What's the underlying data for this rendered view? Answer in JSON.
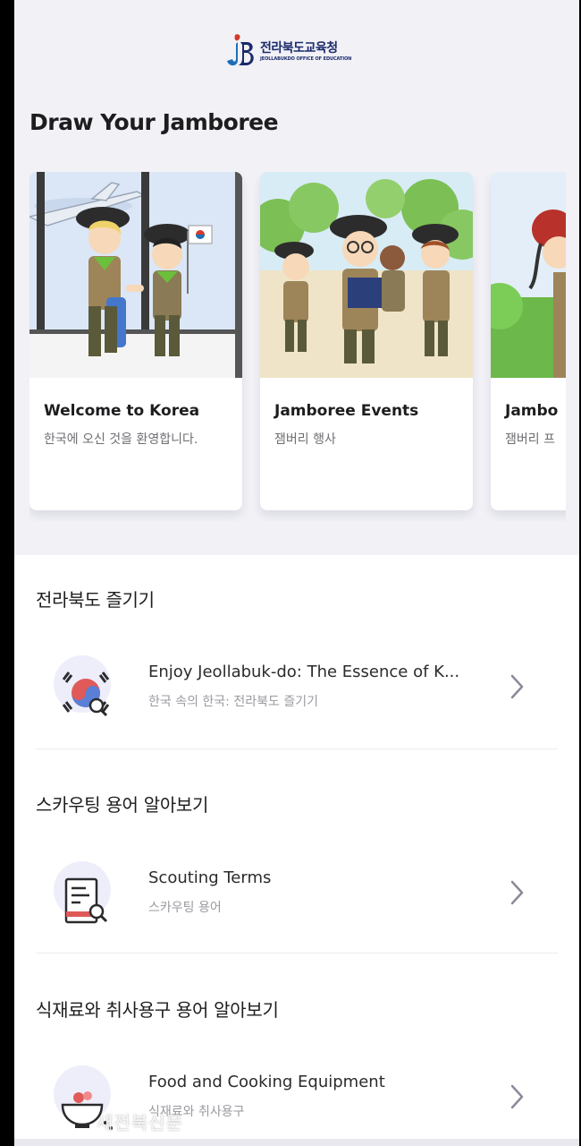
{
  "logo": {
    "ko": "전라북도교육청",
    "en": "JEOLLABUKDO OFFICE OF EDUCATION"
  },
  "page_title": "Draw Your Jamboree",
  "cards": [
    {
      "title": "Welcome to Korea",
      "subtitle": "한국에 오신 것을 환영합니다."
    },
    {
      "title": "Jamboree Events",
      "subtitle": "잼버리 행사"
    },
    {
      "title": "Jambo",
      "subtitle": "잼버리 프"
    }
  ],
  "sections": [
    {
      "title": "전라북도 즐기기",
      "item_title": "Enjoy Jeollabuk-do: The Essence of K...",
      "item_subtitle": "한국 속의 한국: 전라북도 즐기기",
      "icon": "taegeuk-search-icon"
    },
    {
      "title": "스카우팅 용어 알아보기",
      "item_title": "Scouting Terms",
      "item_subtitle": "스카우팅 용어",
      "icon": "book-search-icon"
    },
    {
      "title": "식재료와 취사용구 용어 알아보기",
      "item_title": "Food and Cooking Equipment",
      "item_subtitle": "식재료와 취사용구",
      "icon": "bowl-search-icon"
    }
  ],
  "watermark": "새전북신문",
  "colors": {
    "brand_blue": "#1b2a6b",
    "brand_red": "#d3392c",
    "background": "#f1f1f6",
    "accent_light": "#eeeefb"
  }
}
